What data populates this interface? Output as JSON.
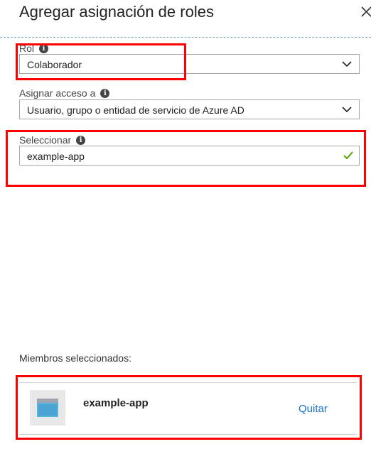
{
  "header": {
    "title": "Agregar asignación de roles",
    "close_icon": "close-icon"
  },
  "role": {
    "label": "Rol",
    "value": "Colaborador",
    "info_icon": "info-icon"
  },
  "assign_access": {
    "label": "Asignar acceso a",
    "value": "Usuario, grupo o entidad de servicio de Azure AD",
    "info_icon": "info-icon"
  },
  "select": {
    "label": "Seleccionar",
    "value": "example-app",
    "status_icon": "checkmark-icon"
  },
  "members": {
    "label": "Miembros seleccionados:",
    "items": [
      {
        "name": "example-app",
        "remove_label": "Quitar",
        "icon": "app-registration-icon"
      }
    ]
  },
  "colors": {
    "highlight": "#ff0000",
    "link": "#1a73c9",
    "valid_check": "#57a300",
    "divider": "#7aa7c7"
  }
}
